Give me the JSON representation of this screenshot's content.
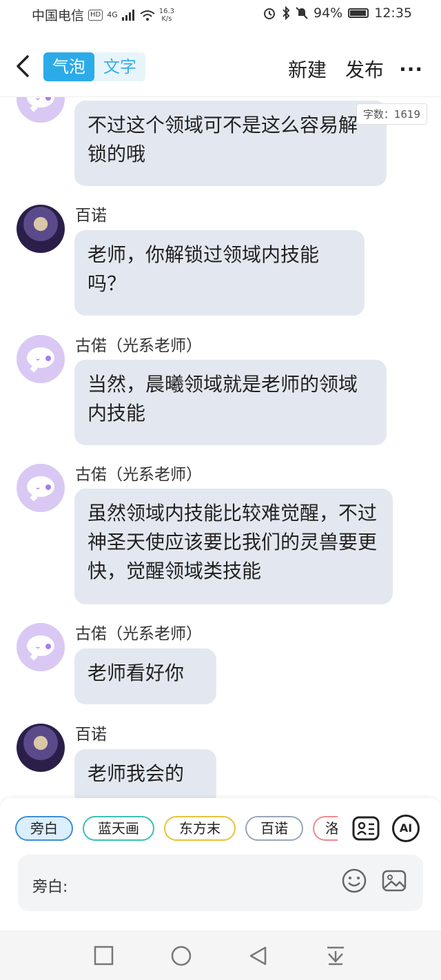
{
  "status": {
    "carrier": "中国电信",
    "hd": "HD",
    "net": "4G",
    "speed_value": "16.3",
    "speed_unit": "K/s",
    "battery": "94%",
    "battery_level": 0.94,
    "time": "12:35"
  },
  "header": {
    "tab_bubble": "气泡",
    "tab_text": "文字",
    "new_label": "新建",
    "publish_label": "发布",
    "more_label": "···"
  },
  "word_count": "字数：1619",
  "messages": [
    {
      "text": "不过这个领域可不是这么容易解锁的哦"
    },
    {
      "name": "百诺",
      "text": "老师，你解锁过领域内技能吗？"
    },
    {
      "name": "古偌（光系老师）",
      "text": "当然，晨曦领域就是老师的领域内技能"
    },
    {
      "name": "古偌（光系老师）",
      "text": "虽然领域内技能比较难觉醒，不过神圣天使应该要比我们的灵兽要更快，觉醒领域类技能"
    },
    {
      "name": "古偌（光系老师）",
      "text": "老师看好你"
    },
    {
      "name": "百诺",
      "text": "老师我会的"
    }
  ],
  "roles": [
    {
      "label": "旁白",
      "color": "#3e8ed8"
    },
    {
      "label": "蓝天画",
      "color": "#3bbfb4"
    },
    {
      "label": "东方末",
      "color": "#e8c23a"
    },
    {
      "label": "百诺",
      "color": "#98a6b6"
    },
    {
      "label": "洛",
      "color": "#f08a8a"
    }
  ],
  "composer": {
    "prefix": "旁白:"
  },
  "buttons": {
    "ai": "AI"
  }
}
